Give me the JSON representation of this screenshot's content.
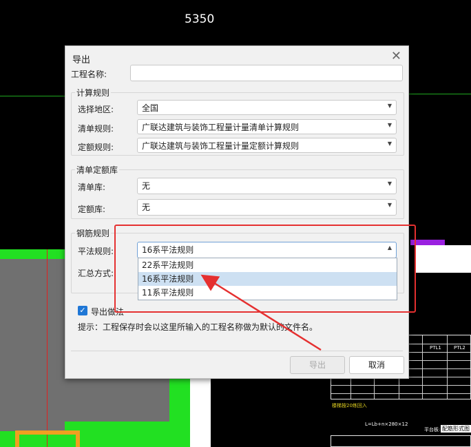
{
  "cad": {
    "title": "5350",
    "label_box": "配筋形式图",
    "platform_label": "平台板:",
    "formula": "L=Lb+n×280×12",
    "yellow_note": "楼梯按20练回入",
    "table_headers": [
      "PTL1",
      "PTL2"
    ]
  },
  "dialog": {
    "title": "导出",
    "project_name_label": "工程名称:",
    "project_name_value": "",
    "calc_rules": {
      "title": "计算规则",
      "region_label": "选择地区:",
      "region_value": "全国",
      "list_rule_label": "清单规则:",
      "list_rule_value": "广联达建筑与装饰工程量计量清单计算规则",
      "quota_rule_label": "定额规则:",
      "quota_rule_value": "广联达建筑与装饰工程量计量定额计算规则"
    },
    "library": {
      "title": "清单定额库",
      "list_lib_label": "清单库:",
      "list_lib_value": "无",
      "quota_lib_label": "定额库:",
      "quota_lib_value": "无"
    },
    "rebar": {
      "title": "钢筋规则",
      "flat_rule_label": "平法规则:",
      "flat_rule_value": "16系平法规则",
      "summary_label": "汇总方式:",
      "options": [
        "22系平法规则",
        "16系平法规则",
        "11系平法规则"
      ],
      "selected_index": 1
    },
    "export_method_label": "导出做法",
    "export_method_checked": true,
    "hint": "提示：工程保存时会以这里所输入的工程名称做为默认的文件名。",
    "export_button": "导出",
    "cancel_button": "取消"
  },
  "colors": {
    "accent": "#1f77d6",
    "annotation": "#e53030",
    "selected_item": "#cde0f2"
  }
}
